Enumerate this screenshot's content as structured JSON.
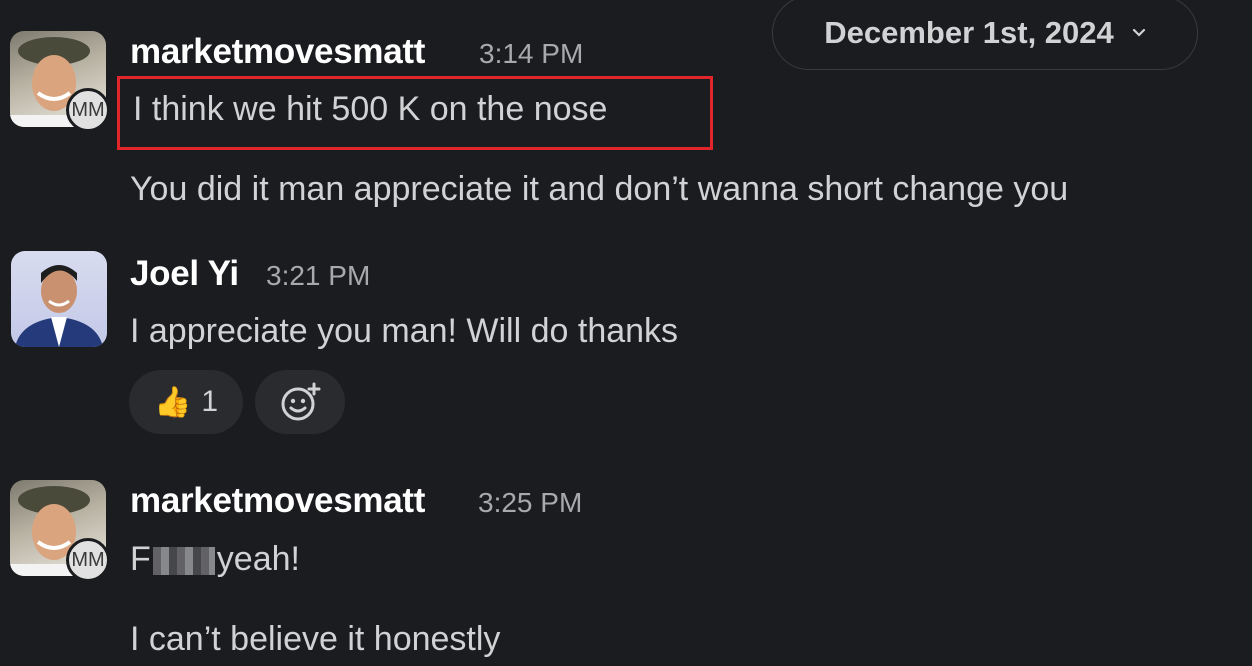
{
  "date_divider": {
    "label": "December 1st, 2024"
  },
  "messages": [
    {
      "author": "marketmovesmatt",
      "time": "3:14 PM",
      "badge": "MM",
      "lines": [
        "I think we hit 500 K on the nose",
        "You did it man appreciate it and don’t wanna short change you"
      ]
    },
    {
      "author": "Joel Yi",
      "time": "3:21 PM",
      "lines": [
        "I appreciate you man! Will do thanks"
      ],
      "reactions": [
        {
          "emoji": "👍",
          "count": "1"
        }
      ]
    },
    {
      "author": "marketmovesmatt",
      "time": "3:25 PM",
      "badge": "MM",
      "lines": [
        "F",
        "yeah!",
        "I can’t believe it honestly"
      ]
    }
  ],
  "colors": {
    "background": "#1b1c1f",
    "highlight_border": "#e0262b",
    "reaction_bg": "#2a2b2e"
  }
}
